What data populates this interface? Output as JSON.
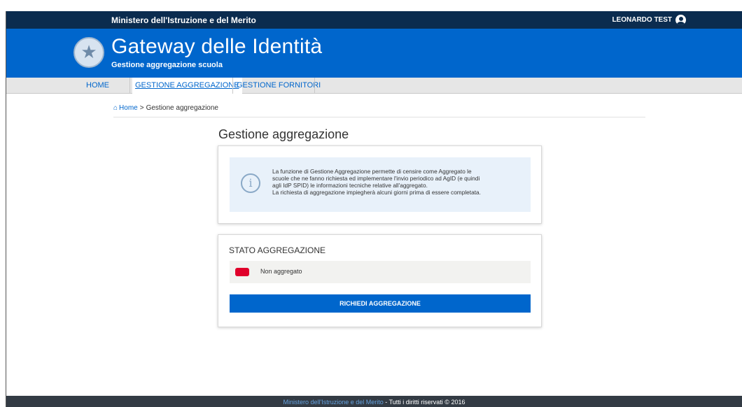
{
  "topbar": {
    "ministry": "Ministero dell'Istruzione e del Merito",
    "user": "LEONARDO TEST",
    "user_icon": "user-circle-icon"
  },
  "header": {
    "title": "Gateway delle Identità",
    "subtitle": "Gestione aggregazione scuola",
    "logo_icon": "republic-emblem-icon"
  },
  "nav": {
    "items": [
      {
        "label": "HOME",
        "active": false
      },
      {
        "label": "GESTIONE AGGREGAZIONE",
        "active": true
      },
      {
        "label": "GESTIONE FORNITORI",
        "active": false
      }
    ]
  },
  "breadcrumb": {
    "home": "Home",
    "separator": ">",
    "current": "Gestione aggregazione",
    "home_icon": "home-icon"
  },
  "page": {
    "title": "Gestione aggregazione"
  },
  "info": {
    "icon": "info-icon",
    "lines": [
      "La funzione di Gestione Aggregazione permette di censire come Aggregato le",
      "scuole che ne fanno richiesta ed implementare l'invio periodico ad AgID (e quindi",
      "agli IdP SPID) le informazioni tecniche relative all'aggregato.",
      "La richiesta di aggregazione impiegherà alcuni giorni prima di essere completata."
    ]
  },
  "status": {
    "title": "STATO AGGREGAZIONE",
    "value": "Non aggregato",
    "status_color": "#e0002a",
    "button": "RICHIEDI AGGREGAZIONE"
  },
  "footer": {
    "link": "Ministero dell'Istruzione e del Merito",
    "text": " - Tutti i diritti riservati © 2016"
  },
  "colors": {
    "primary": "#0066cc",
    "topbar": "#0b2c4f",
    "footer": "#333b44"
  }
}
